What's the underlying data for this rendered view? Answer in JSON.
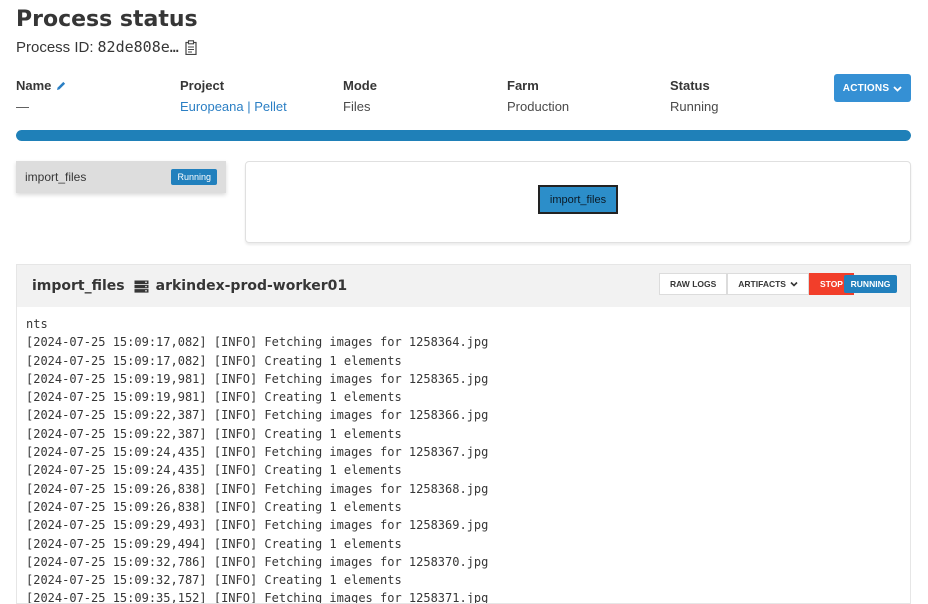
{
  "header": {
    "title": "Process status",
    "process_id_label": "Process ID:",
    "process_id_value": "82de808e…"
  },
  "info": {
    "name": {
      "label": "Name",
      "value": "—"
    },
    "project": {
      "label": "Project",
      "value": "Europeana | Pellet"
    },
    "mode": {
      "label": "Mode",
      "value": "Files"
    },
    "farm": {
      "label": "Farm",
      "value": "Production"
    },
    "status": {
      "label": "Status",
      "value": "Running"
    }
  },
  "actions": {
    "label": "ACTIONS"
  },
  "progress": {
    "fraction": 1.0,
    "color": "#1f80b8"
  },
  "tasks": [
    {
      "name": "import_files",
      "state": "Running"
    }
  ],
  "graph": {
    "node_label": "import_files"
  },
  "log_panel": {
    "task_name": "import_files",
    "worker": "arkindex-prod-worker01",
    "buttons": {
      "raw_logs": "RAW LOGS",
      "artifacts": "ARTIFACTS",
      "stop": "STOP"
    },
    "state_badge": "RUNNING",
    "lines": [
      "nts",
      "[2024-07-25 15:09:17,082] [INFO] Fetching images for 1258364.jpg",
      "[2024-07-25 15:09:17,082] [INFO] Creating 1 elements",
      "[2024-07-25 15:09:19,981] [INFO] Fetching images for 1258365.jpg",
      "[2024-07-25 15:09:19,981] [INFO] Creating 1 elements",
      "[2024-07-25 15:09:22,387] [INFO] Fetching images for 1258366.jpg",
      "[2024-07-25 15:09:22,387] [INFO] Creating 1 elements",
      "[2024-07-25 15:09:24,435] [INFO] Fetching images for 1258367.jpg",
      "[2024-07-25 15:09:24,435] [INFO] Creating 1 elements",
      "[2024-07-25 15:09:26,838] [INFO] Fetching images for 1258368.jpg",
      "[2024-07-25 15:09:26,838] [INFO] Creating 1 elements",
      "[2024-07-25 15:09:29,493] [INFO] Fetching images for 1258369.jpg",
      "[2024-07-25 15:09:29,494] [INFO] Creating 1 elements",
      "[2024-07-25 15:09:32,786] [INFO] Fetching images for 1258370.jpg",
      "[2024-07-25 15:09:32,787] [INFO] Creating 1 elements",
      "[2024-07-25 15:09:35,152] [INFO] Fetching images for 1258371.jpg"
    ]
  },
  "colors": {
    "accent": "#3590d4",
    "running": "#2180bd",
    "stop": "#f23e2a",
    "link": "#2b7fc4"
  },
  "icons": [
    "clipboard-icon",
    "pencil-icon",
    "chevron-down-icon",
    "server-icon"
  ]
}
